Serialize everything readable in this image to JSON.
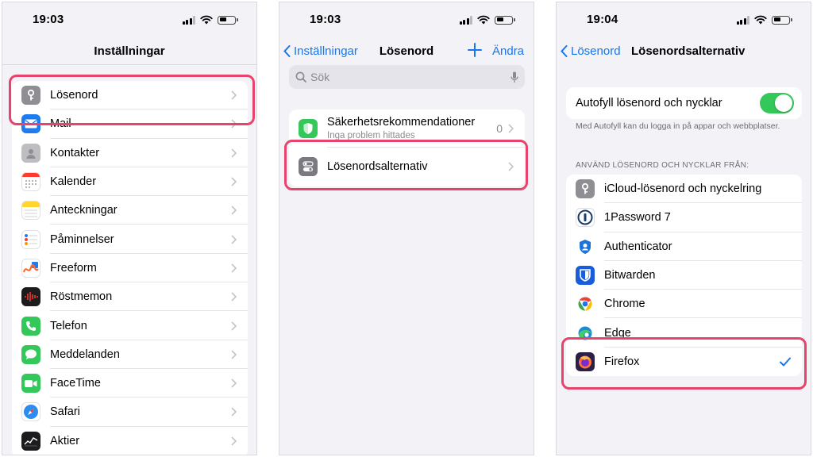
{
  "screen1": {
    "time": "19:03",
    "title": "Inställningar",
    "items": [
      {
        "label": "Lösenord",
        "icon": "key-icon",
        "color": "#8e8e93"
      },
      {
        "label": "Mail",
        "icon": "mail-icon",
        "color": "#1e7cf0"
      },
      {
        "label": "Kontakter",
        "icon": "contacts-icon",
        "color": "#bdbdc2"
      },
      {
        "label": "Kalender",
        "icon": "calendar-icon",
        "color": "#ffffff"
      },
      {
        "label": "Anteckningar",
        "icon": "notes-icon",
        "color": "#ffd52e"
      },
      {
        "label": "Påminnelser",
        "icon": "reminders-icon",
        "color": "#ffffff"
      },
      {
        "label": "Freeform",
        "icon": "freeform-icon",
        "color": "#ffffff"
      },
      {
        "label": "Röstmemon",
        "icon": "voice-memos-icon",
        "color": "#1c1c1e"
      },
      {
        "label": "Telefon",
        "icon": "phone-icon",
        "color": "#34c759"
      },
      {
        "label": "Meddelanden",
        "icon": "messages-icon",
        "color": "#34c759"
      },
      {
        "label": "FaceTime",
        "icon": "facetime-icon",
        "color": "#34c759"
      },
      {
        "label": "Safari",
        "icon": "safari-icon",
        "color": "#ffffff"
      },
      {
        "label": "Aktier",
        "icon": "stocks-icon",
        "color": "#1c1c1e"
      }
    ]
  },
  "screen2": {
    "time": "19:03",
    "back_label": "Inställningar",
    "title": "Lösenord",
    "edit_label": "Ändra",
    "search_placeholder": "Sök",
    "security": {
      "title": "Säkerhetsrekommendationer",
      "subtitle": "Inga problem hittades",
      "count": "0"
    },
    "options_label": "Lösenordsalternativ"
  },
  "screen3": {
    "time": "19:04",
    "back_label": "Lösenord",
    "title": "Lösenordsalternativ",
    "autofill_label": "Autofyll lösenord och nycklar",
    "autofill_on": true,
    "autofill_footer": "Med Autofyll kan du logga in på appar och webbplatser.",
    "section_header": "ANVÄND LÖSENORD OCH NYCKLAR FRÅN:",
    "providers": [
      {
        "label": "iCloud-lösenord och nyckelring",
        "icon": "icloud-keychain-icon",
        "checked": false
      },
      {
        "label": "1Password 7",
        "icon": "1password-icon",
        "checked": false
      },
      {
        "label": "Authenticator",
        "icon": "authenticator-icon",
        "checked": false
      },
      {
        "label": "Bitwarden",
        "icon": "bitwarden-icon",
        "checked": false
      },
      {
        "label": "Chrome",
        "icon": "chrome-icon",
        "checked": false
      },
      {
        "label": "Edge",
        "icon": "edge-icon",
        "checked": false
      },
      {
        "label": "Firefox",
        "icon": "firefox-icon",
        "checked": true
      }
    ]
  },
  "colors": {
    "accent": "#1677f0",
    "highlight": "#e8436c",
    "toggle_on": "#34c759"
  }
}
